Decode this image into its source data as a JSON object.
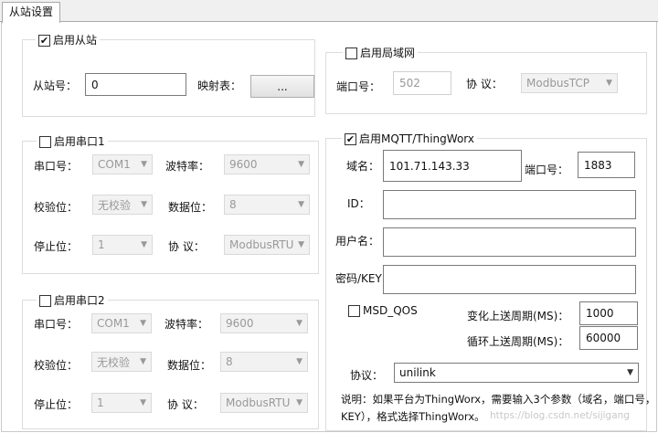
{
  "tab": {
    "label": "从站设置"
  },
  "slave": {
    "enable_label": "启用从站",
    "enabled": true,
    "station_label": "从站号：",
    "station_value": "0",
    "map_label": "映射表：",
    "map_button": "..."
  },
  "lan": {
    "enable_label": "启用局域网",
    "enabled": false,
    "port_label": "端口号：",
    "port_value": "502",
    "protocol_label": "协  议：",
    "protocol_value": "ModbusTCP"
  },
  "serial1": {
    "enable_label": "启用串口1",
    "enabled": false,
    "port_label": "串口号：",
    "port_value": "COM1",
    "baud_label": "波特率：",
    "baud_value": "9600",
    "parity_label": "校验位：",
    "parity_value": "无校验",
    "data_label": "数据位：",
    "data_value": "8",
    "stop_label": "停止位：",
    "stop_value": "1",
    "protocol_label": "协  议：",
    "protocol_value": "ModbusRTU"
  },
  "serial2": {
    "enable_label": "启用串口2",
    "enabled": false,
    "port_label": "串口号：",
    "port_value": "COM1",
    "baud_label": "波特率：",
    "baud_value": "9600",
    "parity_label": "校验位：",
    "parity_value": "无校验",
    "data_label": "数据位：",
    "data_value": "8",
    "stop_label": "停止位：",
    "stop_value": "1",
    "protocol_label": "协  议：",
    "protocol_value": "ModbusRTU"
  },
  "mqtt": {
    "enable_label": "启用MQTT/ThingWorx",
    "enabled": true,
    "domain_label": "域名：",
    "domain_value": "101.71.143.33",
    "port_label": "端口号：",
    "port_value": "1883",
    "id_label": "ID：",
    "id_value": "",
    "user_label": "用户名：",
    "user_value": "",
    "key_label": "密码/KEY",
    "key_value": "",
    "qos_label": "MSD_QOS",
    "qos_checked": false,
    "change_period_label": "变化上送周期(MS)：",
    "change_period_value": "1000",
    "cycle_period_label": "循环上送周期(MS)：",
    "cycle_period_value": "60000",
    "protocol_label": "协议：",
    "protocol_value": "unilink",
    "note_line1": "说明：如果平台为ThingWorx，需要输入3个参数（域名，端口号，",
    "note_line2": "KEY），格式选择ThingWorx。"
  },
  "watermark": "https://blog.csdn.net/sijigang",
  "icons": {
    "check": "✔",
    "dropdown": "▼"
  }
}
